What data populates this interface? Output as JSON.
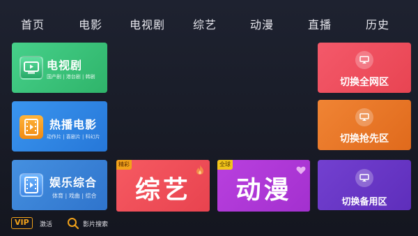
{
  "nav": {
    "items": [
      "首页",
      "电影",
      "电视剧",
      "综艺",
      "动漫",
      "直播",
      "历史"
    ]
  },
  "left_tiles": [
    {
      "title": "电视剧",
      "subtitle": "国产剧 | 港台剧 | 韩剧",
      "icon": "tv-icon"
    },
    {
      "title": "热播电影",
      "subtitle": "动作片 | 喜剧片 | 科幻片",
      "icon": "film-icon"
    },
    {
      "title": "娱乐综合",
      "subtitle": "体育 | 戏曲 | 综合",
      "icon": "video-icon"
    }
  ],
  "right_tiles": [
    {
      "label": "切换全网区",
      "icon": "cast-icon"
    },
    {
      "label": "切换抢先区",
      "icon": "cast-icon"
    },
    {
      "label": "切换备用区",
      "icon": "cast-icon"
    }
  ],
  "big_tiles": [
    {
      "text": "综艺",
      "badge": "精彩",
      "icon": "flame-icon"
    },
    {
      "text": "动漫",
      "badge": "全球",
      "icon": "heart-icon"
    }
  ],
  "footer": {
    "vip_label": "VIP",
    "vip_action": "激活",
    "search_label": "影片搜索"
  },
  "colors": {
    "background": "#1a1d28",
    "tv_tile": "#3ec57c",
    "movie_tile": "#2f88e4",
    "ent_tile": "#3a86d8",
    "variety_tile": "#f0505a",
    "anime_tile": "#b63ad8",
    "switch_all": "#ee4e5a",
    "switch_first": "#e8762a",
    "switch_backup": "#6a35c4",
    "accent": "#f2a21a"
  }
}
